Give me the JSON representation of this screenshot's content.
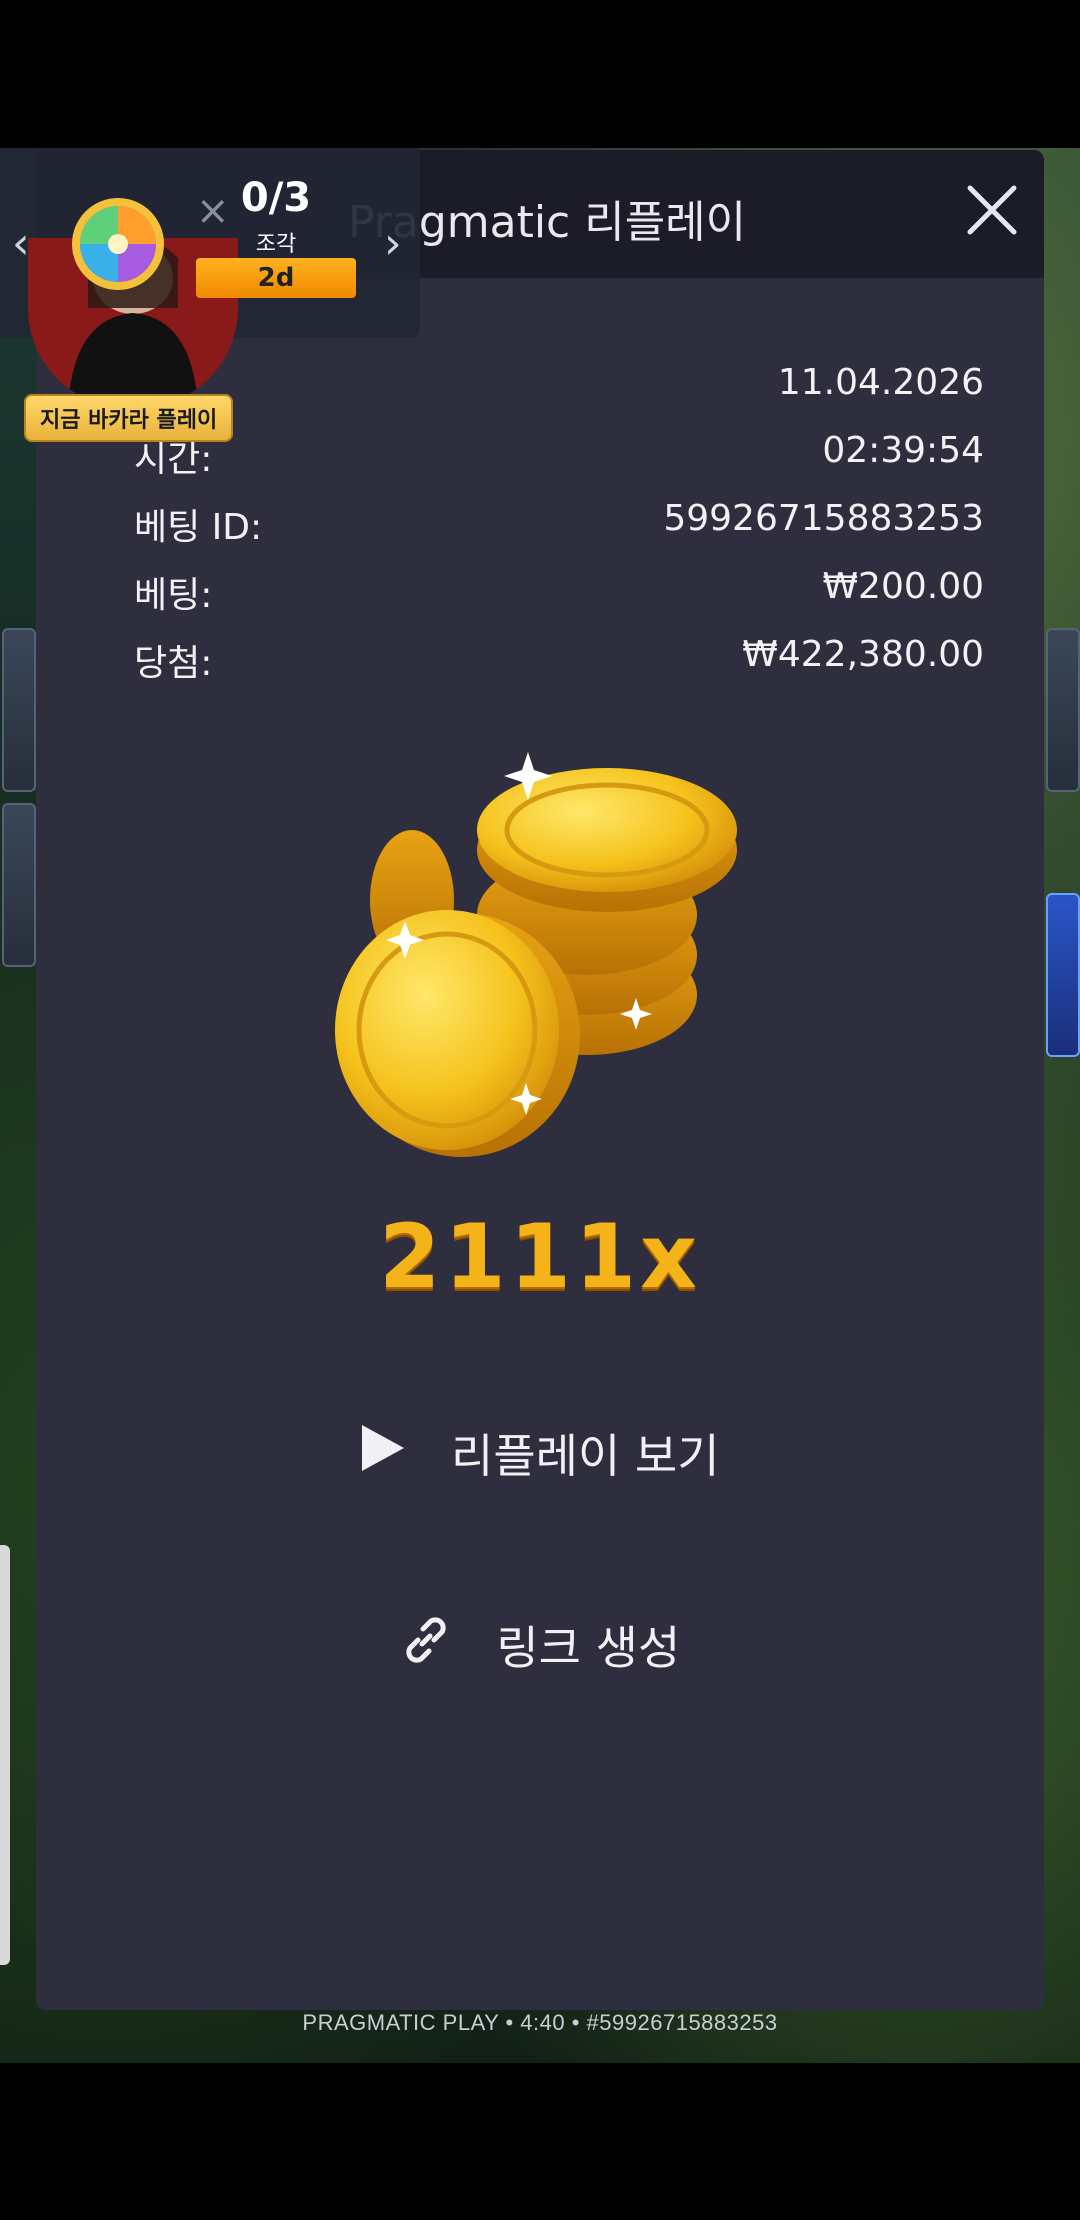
{
  "modal": {
    "title": "Pragmatic 리플레이",
    "rows": [
      {
        "label": "",
        "value": "11.04.2026"
      },
      {
        "label": "시간:",
        "value": "02:39:54"
      },
      {
        "label": "베팅 ID:",
        "value": "59926715883253"
      },
      {
        "label": "베팅:",
        "value": "₩200.00"
      },
      {
        "label": "당첨:",
        "value": "₩422,380.00"
      }
    ],
    "multiplier": "2111x",
    "replay_label": "리플레이 보기",
    "link_label": "링크 생성",
    "close_icon": "close-icon"
  },
  "widget": {
    "count": "0/3",
    "unit": "조각",
    "time_left": "2d",
    "play_badge": "지금 바카라 플레이",
    "prev_icon": "chevron-left-icon",
    "next_icon": "chevron-right-icon"
  },
  "footer": {
    "text": "PRAGMATIC PLAY • 4:40 • #59926715883253"
  },
  "colors": {
    "modal_bg": "#2e2e3e",
    "header_bg": "#1c1c28",
    "multiplier": "#f5b31a",
    "badge": "#f5a300"
  }
}
